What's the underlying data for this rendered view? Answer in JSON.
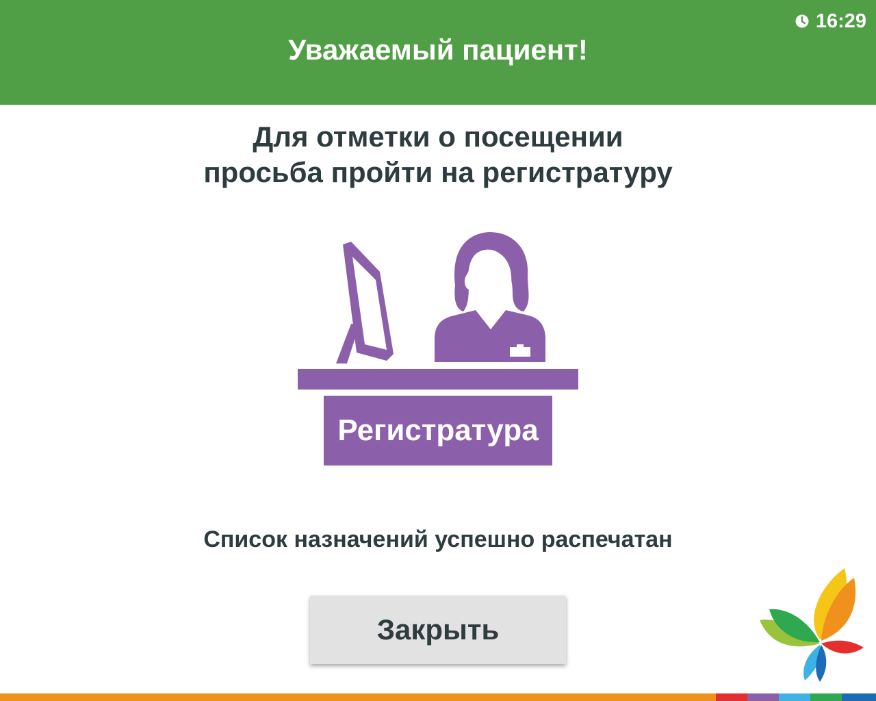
{
  "header": {
    "title": "Уважаемый пациент!",
    "clock": {
      "icon": "clock-icon",
      "time": "16:29"
    }
  },
  "message": {
    "line1": "Для отметки о посещении",
    "line2": "просьба пройти на регистратуру"
  },
  "illustration": {
    "icon": "receptionist-desk-icon",
    "desk_label": "Регистратура"
  },
  "status_text": "Список назначений успешно распечатан",
  "close_button": {
    "label": "Закрыть"
  },
  "logo": {
    "icon": "butterfly-logo-icon"
  },
  "colors": {
    "header_bg": "#509e45",
    "text_dark": "#2f3c3f",
    "illustration_purple": "#8c5faa",
    "button_bg": "#e2e2e2",
    "footer_orange": "#f0911e"
  }
}
